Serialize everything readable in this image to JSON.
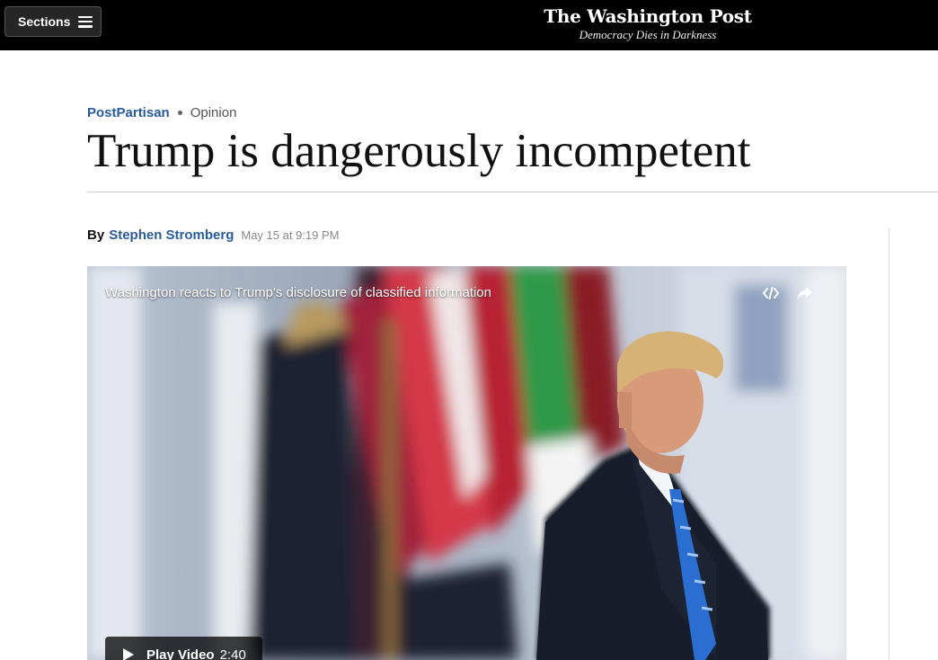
{
  "header": {
    "sections_label": "Sections",
    "logo": "The Washington Post",
    "tagline": "Democracy Dies in Darkness"
  },
  "article": {
    "section": "PostPartisan",
    "label": "Opinion",
    "headline": "Trump is dangerously incompetent",
    "byline_prefix": "By",
    "author": "Stephen Stromberg",
    "date": "May 15 at 9:19 PM"
  },
  "video": {
    "title": "Washington reacts to Trump's disclosure of classified information",
    "play_label": "Play Video",
    "duration": "2:40",
    "icons": [
      "embed-icon",
      "share-icon",
      "play-icon"
    ]
  },
  "colors": {
    "topbar": "#000000",
    "link_blue": "#2a5a9e",
    "headline": "#111111"
  }
}
